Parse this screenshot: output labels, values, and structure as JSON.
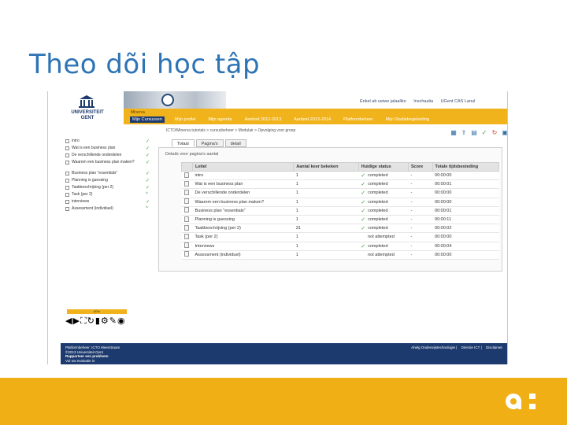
{
  "slide": {
    "title": "Theo dõi học tập"
  },
  "header": {
    "university_lines": [
      "UNIVERSITEIT",
      "GENT"
    ],
    "top_links": [
      "Enkel ab ueiwe jalaaliko",
      "Inschaalia",
      "UGent CAS Lanul"
    ],
    "site_name": "Minerva",
    "nav": [
      "Mijn Cursussen",
      "Mijn profiel",
      "Mijn agenda",
      "Aanbod 2012-2013",
      "Aanbod 2013-2014",
      "Platformbeheer",
      "Mijn Studiebegeleiding"
    ],
    "breadcrumb": "ICTO/Minerva tutorials > cursusbeheer > Modulair > Opvolging voor groep"
  },
  "tree": {
    "items": [
      {
        "label": "intro",
        "status": "✓"
      },
      {
        "label": "Wat is een business plan",
        "status": "✓"
      },
      {
        "label": "De verschillende onderdelen",
        "status": "✓"
      },
      {
        "label": "Waarom een business plan maken?",
        "status": "✓"
      },
      {
        "label": "Business plan \"essentials\"",
        "status": "✓"
      },
      {
        "label": "Planning is guessing",
        "status": "✓"
      },
      {
        "label": "Taakbeschrijving (per 2)",
        "status": "✓"
      },
      {
        "label": "Task (per 2)",
        "status": "^"
      },
      {
        "label": "interviews",
        "status": "✓"
      },
      {
        "label": "Assessment (individuel)",
        "status": "^"
      }
    ]
  },
  "player": {
    "progress_label": "80%"
  },
  "tabs": [
    "Totaal",
    "Pagina's",
    "detail"
  ],
  "results": {
    "title": "Details voor pagina's aantal",
    "columns": [
      "Leitel",
      "Aantal keer bekeken",
      "Huidige status",
      "Score",
      "Totale tijdsbesteding"
    ],
    "rows": [
      {
        "title": "intro",
        "views": "1",
        "check": "✓",
        "status": "completed",
        "score": "-",
        "time": "00:00:00"
      },
      {
        "title": "Wat is een business plan",
        "views": "1",
        "check": "✓",
        "status": "completed",
        "score": "-",
        "time": "00:00:01"
      },
      {
        "title": "De verschillende onderdelen",
        "views": "1",
        "check": "✓",
        "status": "completed",
        "score": "-",
        "time": "00:00:00"
      },
      {
        "title": "Waarom een business plan maken?",
        "views": "1",
        "check": "✓",
        "status": "completed",
        "score": "-",
        "time": "00:00:00"
      },
      {
        "title": "Business plan \"essentials\"",
        "views": "1",
        "check": "✓",
        "status": "completed",
        "score": "-",
        "time": "00:00:01"
      },
      {
        "title": "Planning is guessing",
        "views": "1",
        "check": "✓",
        "status": "completed",
        "score": "-",
        "time": "00:00:11"
      },
      {
        "title": "Taakbeschrijving (per 2)",
        "views": "31",
        "check": "✓",
        "status": "completed",
        "score": "-",
        "time": "00:00:02"
      },
      {
        "title": "Task (per 2)",
        "views": "1",
        "check": "",
        "status": "not attempted",
        "score": "-",
        "time": "00:00:00"
      },
      {
        "title": "Interviews",
        "views": "1",
        "check": "✓",
        "status": "completed",
        "score": "-",
        "time": "00:00:04"
      },
      {
        "title": "Assessment (individuel)",
        "views": "1",
        "check": "",
        "status": "not attempted",
        "score": "-",
        "time": "00:00:00"
      }
    ]
  },
  "footer": {
    "left_lines": [
      "Platformbeheer: ICTO Meerstraam",
      "©2013 Universiteit Gent",
      "Rapporteer een probleem",
      "Vul uw evaluatie in"
    ],
    "right_links": [
      "Ahelg Onderwijstechnologie",
      "Directie ICT",
      "Disclaimer"
    ]
  },
  "colors": {
    "title": "#2e74b5",
    "navbar": "#f1b31c",
    "footer": "#1d3a6e",
    "band": "#f0b015",
    "check": "#3a9a3a"
  }
}
